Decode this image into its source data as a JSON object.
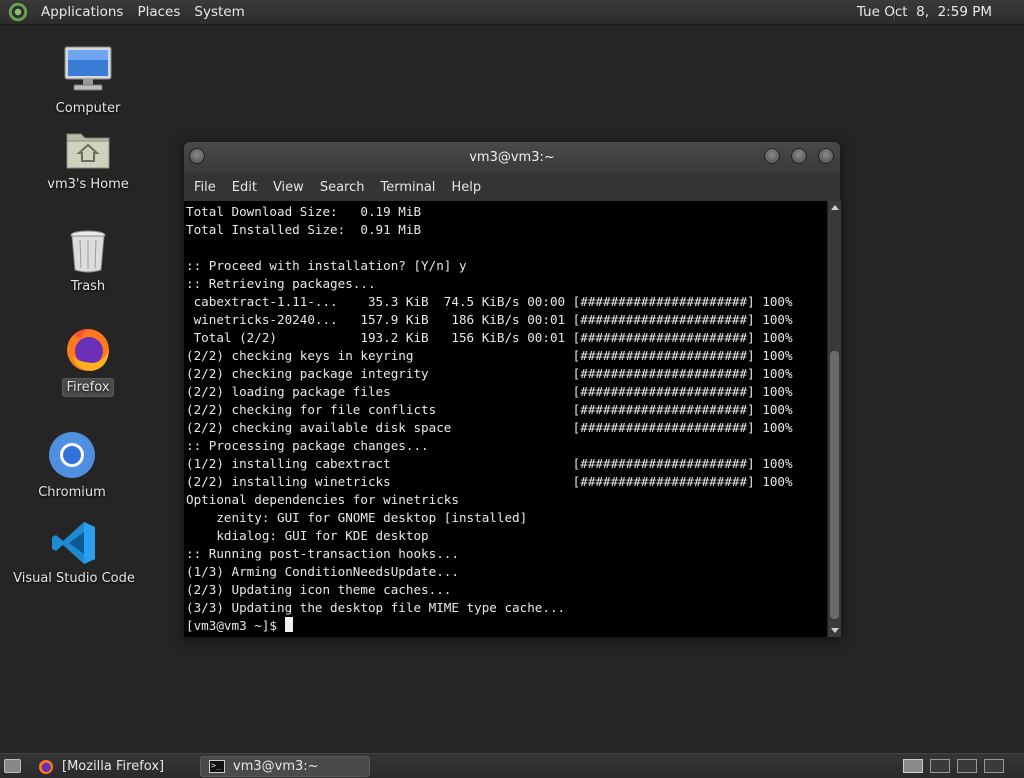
{
  "top_panel": {
    "menus": [
      "Applications",
      "Places",
      "System"
    ],
    "clock": "Tue Oct  8,  2:59 PM"
  },
  "desktop_icons": [
    {
      "label": "Computer",
      "icon": "computer-icon"
    },
    {
      "label": "vm3's Home",
      "icon": "home-folder-icon"
    },
    {
      "label": "Trash",
      "icon": "trash-icon"
    },
    {
      "label": "Firefox",
      "icon": "firefox-icon",
      "selected": true
    },
    {
      "label": "Chromium",
      "icon": "chromium-icon"
    },
    {
      "label": "Visual Studio Code",
      "icon": "vscode-icon"
    }
  ],
  "window": {
    "title": "vm3@vm3:~",
    "menu": [
      "File",
      "Edit",
      "View",
      "Search",
      "Terminal",
      "Help"
    ]
  },
  "terminal": {
    "lines": [
      "Total Download Size:   0.19 MiB",
      "Total Installed Size:  0.91 MiB",
      "",
      ":: Proceed with installation? [Y/n] y",
      ":: Retrieving packages...",
      " cabextract-1.11-...    35.3 KiB  74.5 KiB/s 00:00 [######################] 100%",
      " winetricks-20240...   157.9 KiB   186 KiB/s 00:01 [######################] 100%",
      " Total (2/2)           193.2 KiB   156 KiB/s 00:01 [######################] 100%",
      "(2/2) checking keys in keyring                     [######################] 100%",
      "(2/2) checking package integrity                   [######################] 100%",
      "(2/2) loading package files                        [######################] 100%",
      "(2/2) checking for file conflicts                  [######################] 100%",
      "(2/2) checking available disk space                [######################] 100%",
      ":: Processing package changes...",
      "(1/2) installing cabextract                        [######################] 100%",
      "(2/2) installing winetricks                        [######################] 100%",
      "Optional dependencies for winetricks",
      "    zenity: GUI for GNOME desktop [installed]",
      "    kdialog: GUI for KDE desktop",
      ":: Running post-transaction hooks...",
      "(1/3) Arming ConditionNeedsUpdate...",
      "(2/3) Updating icon theme caches...",
      "(3/3) Updating the desktop file MIME type cache..."
    ],
    "prompt": "[vm3@vm3 ~]$ "
  },
  "taskbar": {
    "tasks": [
      {
        "label": "[Mozilla Firefox]",
        "icon": "firefox-icon",
        "active": false
      },
      {
        "label": "vm3@vm3:~",
        "icon": "terminal-icon",
        "active": true
      }
    ]
  }
}
